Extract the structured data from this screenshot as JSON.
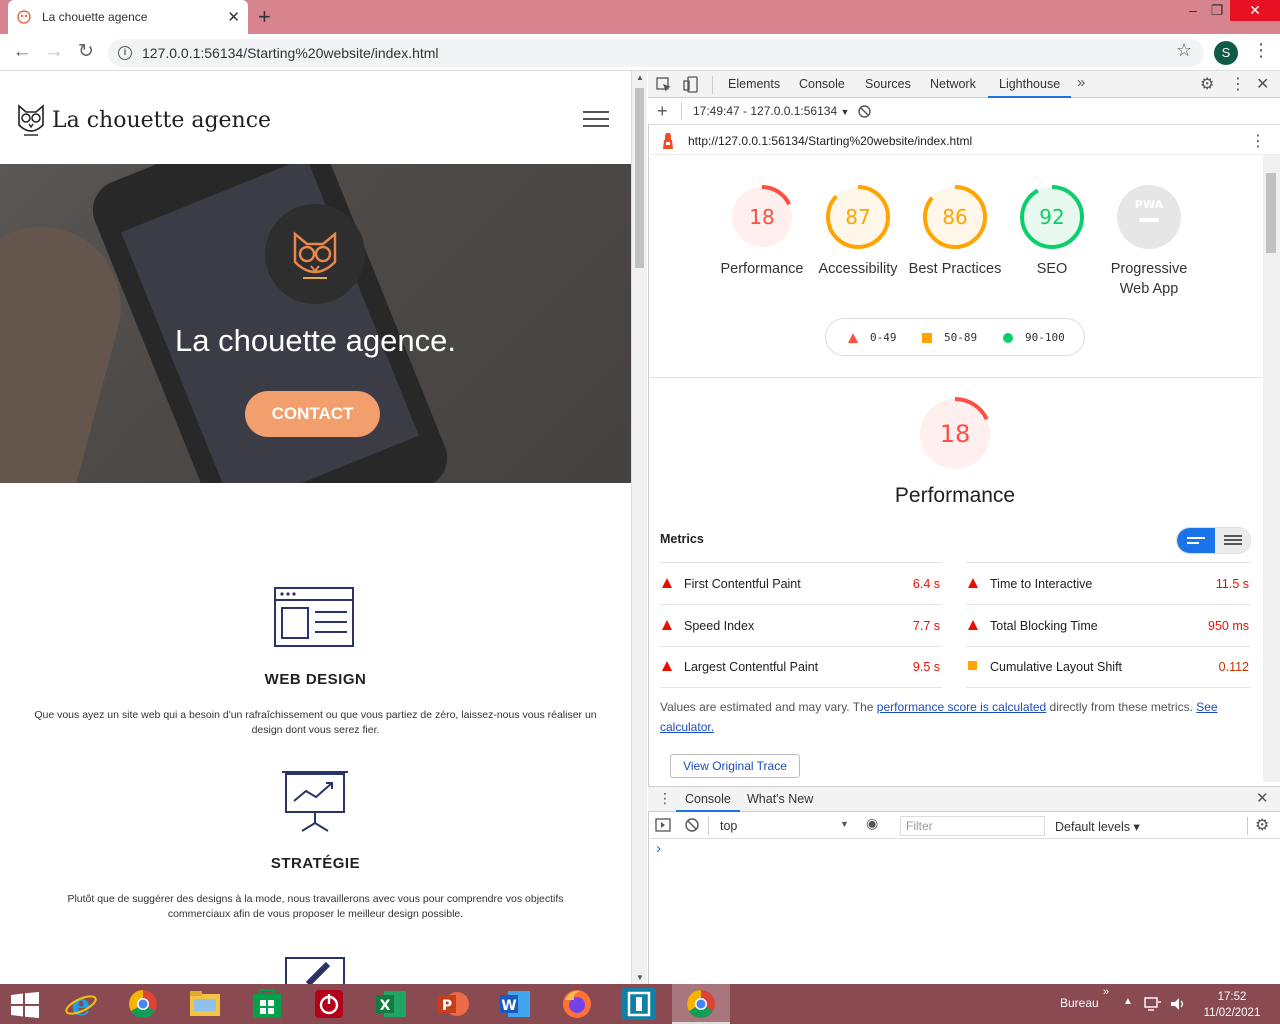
{
  "browser": {
    "tab_title": "La chouette agence",
    "tab_close": "✕",
    "new_tab": "+",
    "url": "127.0.0.1:56134/Starting%20website/index.html",
    "avatar_letter": "S",
    "window_controls": [
      "–",
      "❐",
      "✕"
    ]
  },
  "site": {
    "brand": "La chouette agence",
    "hero_title": "La chouette agence.",
    "contact_label": "CONTACT",
    "services": [
      {
        "title": "WEB DESIGN",
        "text": "Que vous ayez un site web qui a besoin d'un rafraîchissement ou que vous partiez de zéro, laissez-nous vous réaliser un design dont vous serez fier."
      },
      {
        "title": "STRATÉGIE",
        "text": "Plutôt que de suggérer des designs à la mode, nous travaillerons avec vous pour comprendre vos objectifs commerciaux afin de vous proposer le meilleur design possible."
      }
    ]
  },
  "devtools": {
    "tabs": [
      "Elements",
      "Console",
      "Sources",
      "Network",
      "Lighthouse"
    ],
    "active_tab": "Lighthouse",
    "report_selector": "17:49:47 - 127.0.0.1:56134",
    "report_url": "http://127.0.0.1:56134/Starting%20website/index.html",
    "categories": [
      {
        "label": "Performance",
        "score": 18,
        "score_text": "18",
        "color": "#ff4e42",
        "fill": 0.18
      },
      {
        "label": "Accessibility",
        "score": 87,
        "score_text": "87",
        "color": "#ffa400",
        "fill": 0.87
      },
      {
        "label": "Best Practices",
        "score": 86,
        "score_text": "86",
        "color": "#ffa400",
        "fill": 0.86
      },
      {
        "label": "SEO",
        "score": 92,
        "score_text": "92",
        "color": "#0cce6b",
        "fill": 0.92
      },
      {
        "label": "Progressive Web App",
        "score_text": "PWA",
        "color": "#9e9e9e"
      }
    ],
    "legend": [
      {
        "range": "0-49",
        "color": "#ff4e42",
        "shape": "triangle"
      },
      {
        "range": "50-89",
        "color": "#ffa400",
        "shape": "square"
      },
      {
        "range": "90-100",
        "color": "#0cce6b",
        "shape": "circle"
      }
    ],
    "performance_score": "18",
    "performance_title": "Performance",
    "metrics_title": "Metrics",
    "metrics": [
      {
        "label": "First Contentful Paint",
        "value": "6.4 s",
        "status": "fail"
      },
      {
        "label": "Time to Interactive",
        "value": "11.5 s",
        "status": "fail"
      },
      {
        "label": "Speed Index",
        "value": "7.7 s",
        "status": "fail"
      },
      {
        "label": "Total Blocking Time",
        "value": "950 ms",
        "status": "fail"
      },
      {
        "label": "Largest Contentful Paint",
        "value": "9.5 s",
        "status": "fail"
      },
      {
        "label": "Cumulative Layout Shift",
        "value": "0.112",
        "status": "average"
      }
    ],
    "note_prefix": "Values are estimated and may vary. The ",
    "note_link1": "performance score is calculated",
    "note_mid": " directly from these metrics. ",
    "note_link2": "See calculator.",
    "view_trace": "View Original Trace",
    "drawer": {
      "tabs": [
        "Console",
        "What's New"
      ],
      "context": "top",
      "filter_placeholder": "Filter",
      "levels": "Default levels ▾",
      "prompt": "›"
    }
  },
  "taskbar": {
    "desktop_label": "Bureau",
    "time": "17:52",
    "date": "11/02/2021"
  }
}
